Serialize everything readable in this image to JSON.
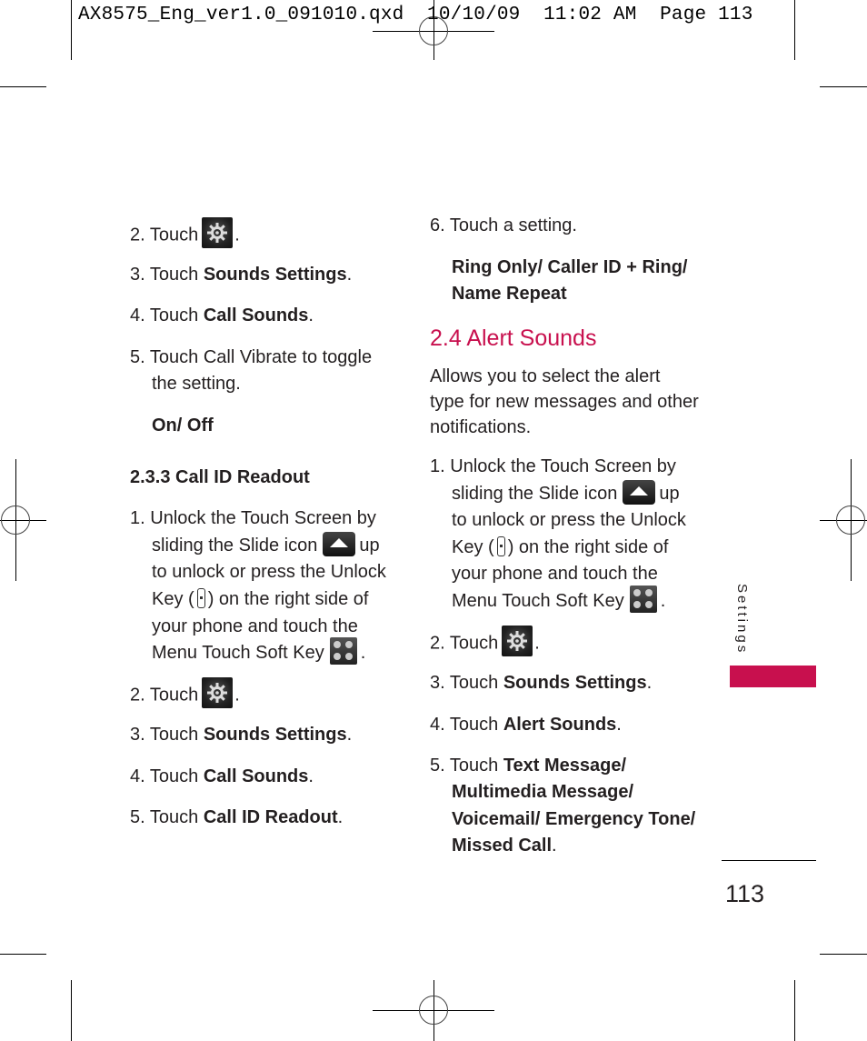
{
  "slug_line": "AX8575_Eng_ver1.0_091010.qxd  10/10/09  11:02 AM  Page 113",
  "colors": {
    "accent": "#c8104e",
    "text": "#231f20"
  },
  "left_column": {
    "steps_a": [
      {
        "num": "2.",
        "prefix": "Touch",
        "icon": "gear-icon",
        "suffix": "."
      },
      {
        "num": "3.",
        "prefix": "Touch",
        "bold": "Sounds Settings",
        "suffix": "."
      },
      {
        "num": "4.",
        "prefix": "Touch",
        "bold": "Call Sounds",
        "suffix": "."
      },
      {
        "num": "5.",
        "line1": "Touch Call Vibrate to toggle",
        "line2": "the setting."
      }
    ],
    "options_a": "On/ Off",
    "subheading": "2.3.3 Call ID Readout",
    "step1": {
      "num": "1.",
      "line1": "Unlock the Touch Screen by",
      "line2_pre": "sliding the Slide icon",
      "line2_post": "up",
      "line3": "to unlock or press the Unlock",
      "line4_pre": "Key (",
      "line4_post": ") on the right side of",
      "line5": "your phone and touch the",
      "line6_pre": "Menu Touch Soft Key",
      "line6_post": "."
    },
    "steps_b": [
      {
        "num": "2.",
        "prefix": "Touch",
        "icon": "gear-icon",
        "suffix": "."
      },
      {
        "num": "3.",
        "prefix": "Touch",
        "bold": "Sounds Settings",
        "suffix": "."
      },
      {
        "num": "4.",
        "prefix": "Touch",
        "bold": "Call Sounds",
        "suffix": "."
      },
      {
        "num": "5.",
        "prefix": "Touch",
        "bold": "Call ID Readout",
        "suffix": "."
      }
    ]
  },
  "right_column": {
    "step6": {
      "num": "6.",
      "text": "Touch a setting."
    },
    "options_line1": "Ring Only/ Caller ID + Ring/",
    "options_line2": "Name Repeat",
    "section_heading": "2.4 Alert Sounds",
    "intro": [
      "Allows you to select the alert",
      "type for new messages and other",
      "notifications."
    ],
    "step1": {
      "num": "1.",
      "line1": "Unlock the Touch Screen by",
      "line2_pre": "sliding the Slide icon",
      "line2_post": "up",
      "line3": "to unlock or press the Unlock",
      "line4_pre": "Key (",
      "line4_post": ") on the right side of",
      "line5": "your phone and touch the",
      "line6_pre": "Menu Touch Soft Key",
      "line6_post": "."
    },
    "steps": [
      {
        "num": "2.",
        "prefix": "Touch",
        "icon": "gear-icon",
        "suffix": "."
      },
      {
        "num": "3.",
        "prefix": "Touch",
        "bold": "Sounds Settings",
        "suffix": "."
      },
      {
        "num": "4.",
        "prefix": "Touch",
        "bold": "Alert Sounds",
        "suffix": "."
      }
    ],
    "step5": {
      "num": "5.",
      "prefix": "Touch",
      "bold_lines": [
        "Text Message/",
        "Multimedia Message/",
        "Voicemail/ Emergency Tone/",
        "Missed Call"
      ],
      "suffix": "."
    }
  },
  "side_tab": {
    "label": "Settings"
  },
  "page_number": "113"
}
